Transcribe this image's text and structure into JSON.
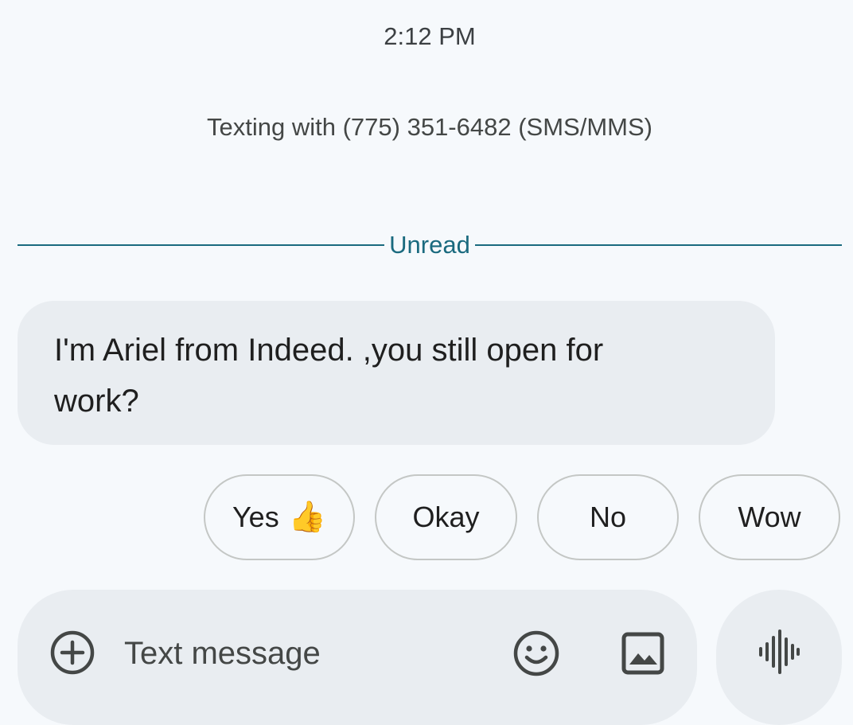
{
  "conversation": {
    "timestamp": "2:12 PM",
    "texting_with": "Texting with (775) 351-6482 (SMS/MMS)",
    "unread_label": "Unread"
  },
  "message": {
    "text": "I'm Ariel from Indeed. ,you still open for work?"
  },
  "smart_replies": [
    {
      "label": "Yes",
      "emoji": "👍"
    },
    {
      "label": "Okay"
    },
    {
      "label": "No"
    },
    {
      "label": "Wow"
    }
  ],
  "composer": {
    "placeholder": "Text message",
    "icons": [
      "add-circle-icon",
      "emoji-icon",
      "image-icon",
      "voice-waveform-icon"
    ]
  },
  "colors": {
    "background": "#f6f9fc",
    "bubble": "#e9edf1",
    "unread_accent": "#1a6a7f",
    "chip_border": "#c4c7c5"
  }
}
